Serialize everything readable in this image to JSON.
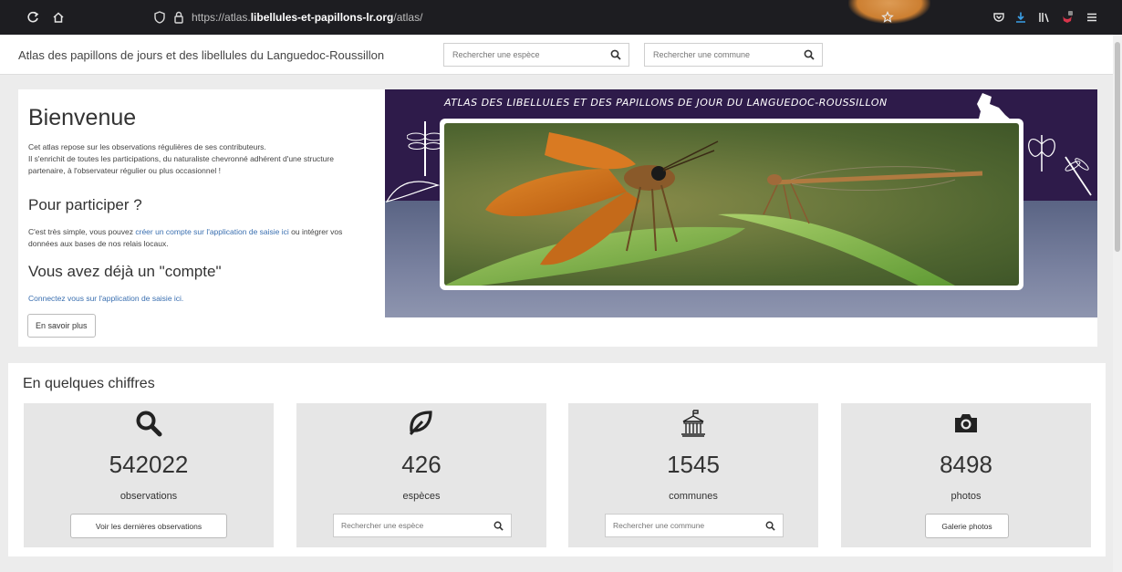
{
  "browser": {
    "url_prefix": "https://atlas.",
    "url_domain": "libellules-et-papillons-lr.org",
    "url_path": "/atlas/"
  },
  "header": {
    "site_title": "Atlas des papillons de jours et des libellules du Languedoc-Roussillon",
    "species_search_placeholder": "Rechercher une espèce",
    "commune_search_placeholder": "Rechercher une commune"
  },
  "welcome": {
    "title": "Bienvenue",
    "intro_line1": "Cet atlas repose sur les observations régulières de ses contributeurs.",
    "intro_line2": "Il s'enrichit de toutes les participations, du naturaliste chevronné adhérent d'une structure partenaire, à l'observateur régulier ou plus occasionnel !",
    "participate_title": "Pour participer ?",
    "participate_text_a": "C'est très simple, vous pouvez ",
    "participate_link": "créer un compte sur l'application de saisie ici",
    "participate_text_b": " ou intégrer vos données aux bases de nos relais locaux.",
    "account_title": "Vous avez déjà un \"compte\"",
    "account_link": "Connectez vous sur l'application de saisie ici.",
    "more_button": "En savoir plus"
  },
  "banner": {
    "title": "ATLAS DES LIBELLULES ET DES PAPILLONS DE JOUR DU LANGUEDOC-ROUSSILLON"
  },
  "stats": {
    "title": "En quelques chiffres",
    "cards": [
      {
        "icon": "search-icon",
        "value": "542022",
        "label": "observations",
        "button": "Voir les dernières observations"
      },
      {
        "icon": "leaf-icon",
        "value": "426",
        "label": "espèces",
        "search_placeholder": "Rechercher une espèce"
      },
      {
        "icon": "town-hall-icon",
        "value": "1545",
        "label": "communes",
        "search_placeholder": "Rechercher une commune"
      },
      {
        "icon": "camera-icon",
        "value": "8498",
        "label": "photos",
        "button": "Galerie photos"
      }
    ]
  },
  "colors": {
    "browser_bar": "#1d1d21",
    "banner_purple": "#2e1b4a",
    "link_blue": "#3a6fb0",
    "card_gray": "#e6e6e6"
  }
}
